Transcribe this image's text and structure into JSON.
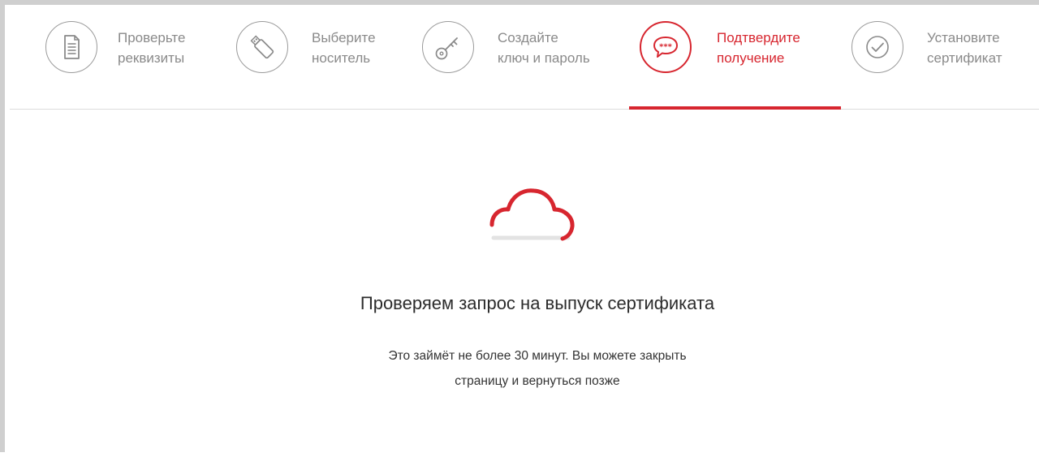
{
  "steps": [
    {
      "id": "check",
      "line1": "Проверьте",
      "line2": "реквизиты",
      "icon": "document-icon",
      "active": false
    },
    {
      "id": "media",
      "line1": "Выберите",
      "line2": "носитель",
      "icon": "usb-drive-icon",
      "active": false
    },
    {
      "id": "key",
      "line1": "Создайте",
      "line2": "ключ и пароль",
      "icon": "key-icon",
      "active": false
    },
    {
      "id": "confirm",
      "line1": "Подтвердите",
      "line2": "получение",
      "icon": "chat-bubble-icon",
      "active": true
    },
    {
      "id": "install",
      "line1": "Установите",
      "line2": "сертификат",
      "icon": "checkmark-icon",
      "active": false
    }
  ],
  "main": {
    "heading": "Проверяем запрос на выпуск сертификата",
    "description_line1": "Это займёт не более 30 минут. Вы можете закрыть",
    "description_line2": "страницу и вернуться позже"
  },
  "colors": {
    "accent": "#d7262f",
    "inactive": "#9b9b9b",
    "text": "#2b2b2b"
  }
}
